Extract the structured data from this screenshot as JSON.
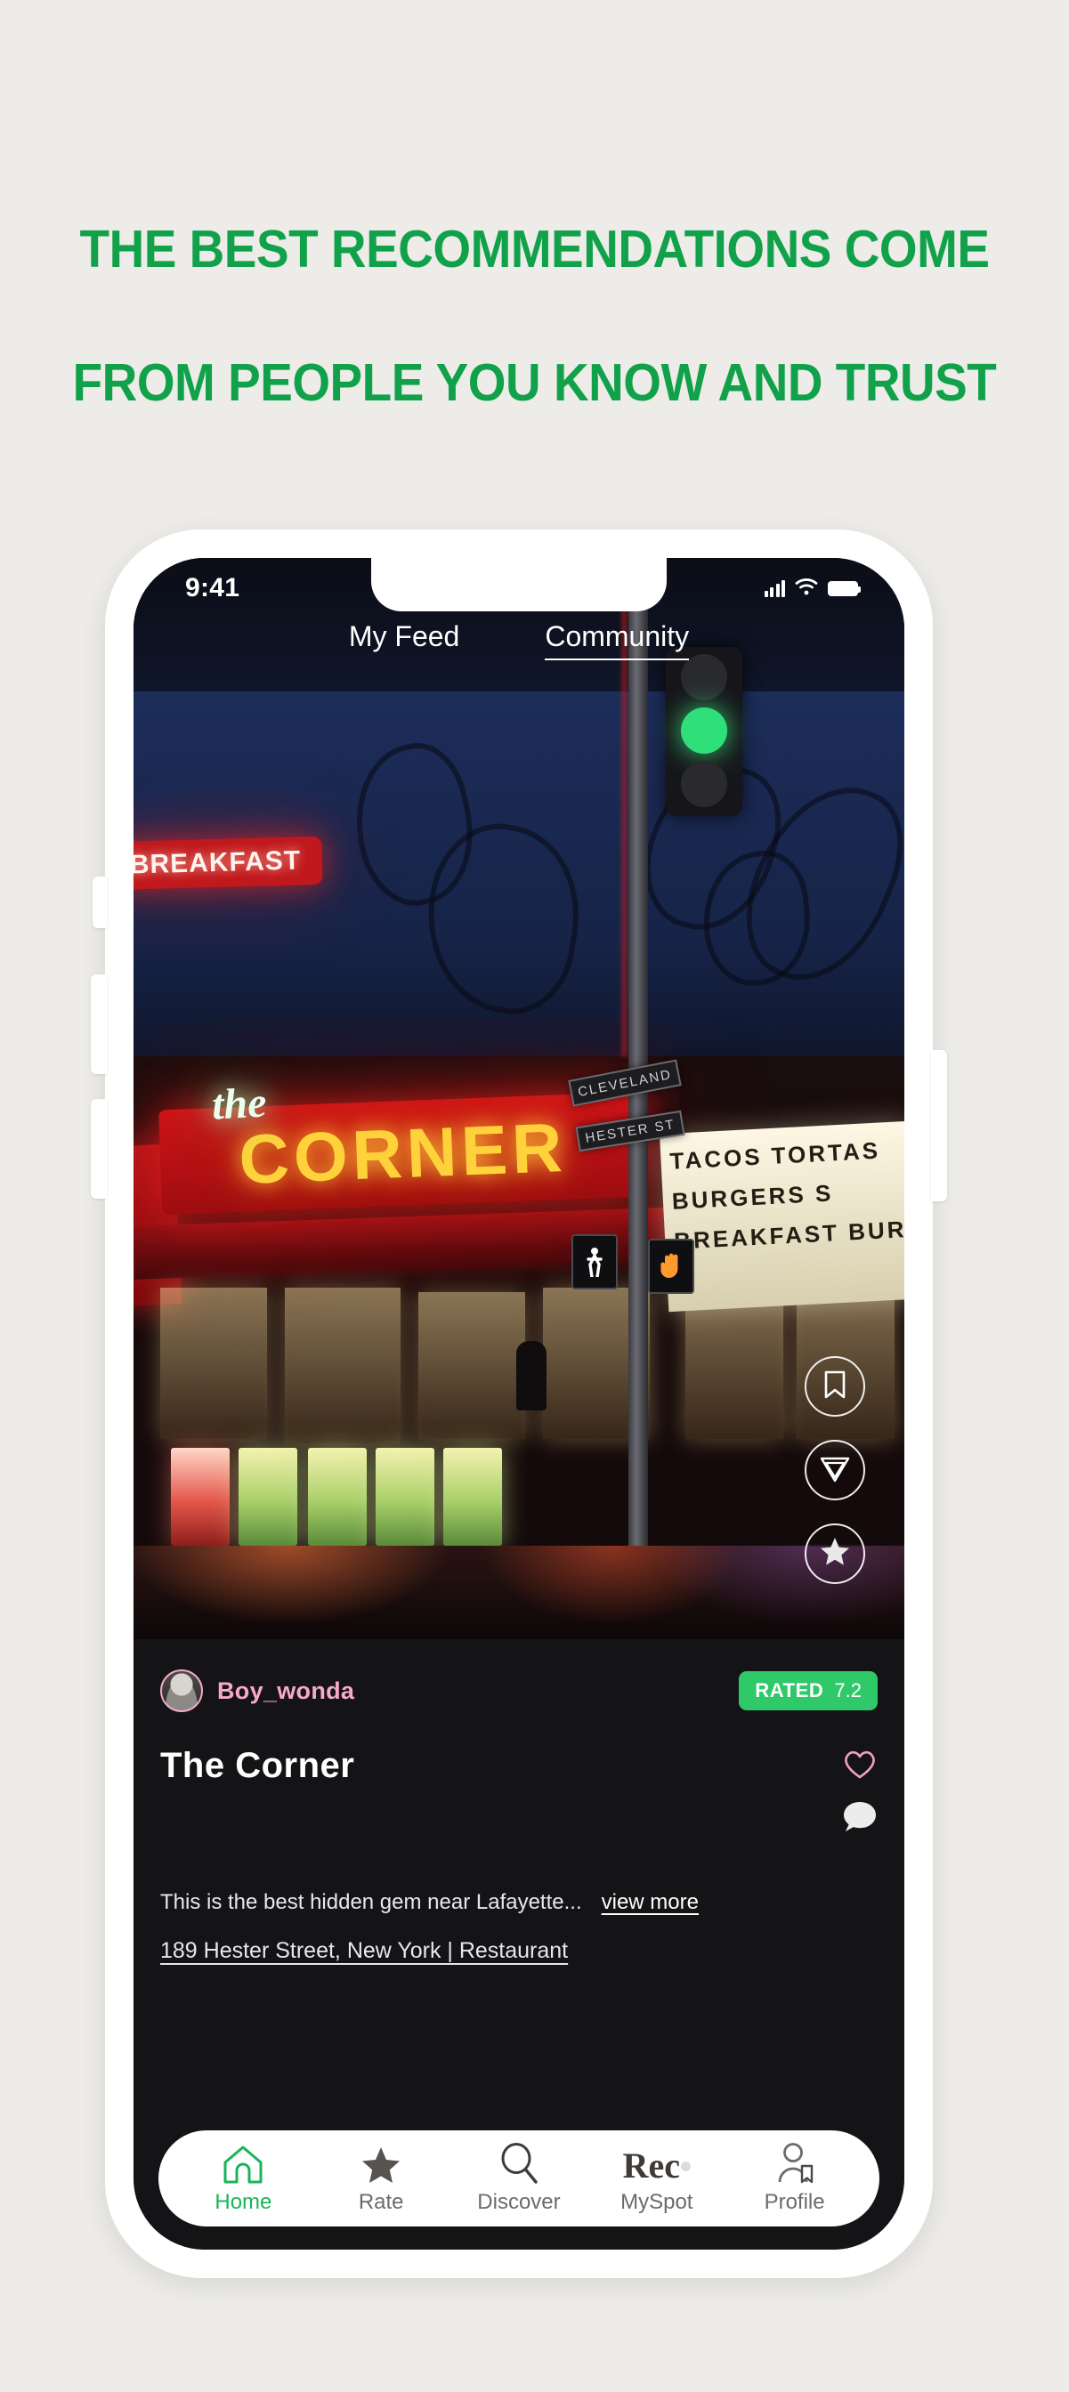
{
  "headline": {
    "line1": "THE BEST RECOMMENDATIONS COME",
    "line2": "FROM PEOPLE YOU KNOW AND TRUST",
    "color": "#11a14a"
  },
  "phone": {
    "status_bar": {
      "time": "9:41",
      "signal_icon": "cellular-bars-icon",
      "wifi_icon": "wifi-icon",
      "battery_icon": "battery-full-icon"
    },
    "tabs": [
      {
        "label": "My Feed",
        "active": false
      },
      {
        "label": "Community",
        "active": true
      }
    ],
    "photo": {
      "neon_the": "the",
      "neon_corner": "CORNER",
      "sign_breakfast": "BREAKFAST",
      "street_sign_1": "CLEVELAND",
      "street_sign_2": "HESTER ST",
      "marquee_line_1": "TACOS TORTAS",
      "marquee_line_2": "BURGERS  S",
      "marquee_line_3": "BREAKFAST BURRIT",
      "walk_glyph": "Ὣ6",
      "hand_glyph": "✋"
    },
    "photo_actions": [
      {
        "name": "bookmark-button",
        "icon": "bookmark-icon"
      },
      {
        "name": "share-button",
        "icon": "send-paper-plane-icon"
      },
      {
        "name": "rate-button",
        "icon": "star-filled-icon"
      }
    ],
    "post": {
      "username": "Boy_wonda",
      "rating_label": "RATED",
      "rating_value": "7.2",
      "rating_color": "#2fc96a",
      "venue": "The Corner",
      "description": "This is the best hidden gem near Lafayette...",
      "view_more": "view more",
      "address": "189 Hester Street, New York | Restaurant",
      "like_icon": "heart-outline-icon",
      "comment_icon": "comment-bubble-icon"
    },
    "nav": [
      {
        "label": "Home",
        "icon": "home-icon",
        "active": true
      },
      {
        "label": "Rate",
        "icon": "star-icon",
        "active": false
      },
      {
        "label": "Discover",
        "icon": "search-icon",
        "active": false
      },
      {
        "label": "MySpot",
        "icon": "rec-logo-icon",
        "active": false,
        "logo": "Rec"
      },
      {
        "label": "Profile",
        "icon": "profile-bookmark-icon",
        "active": false
      }
    ]
  }
}
